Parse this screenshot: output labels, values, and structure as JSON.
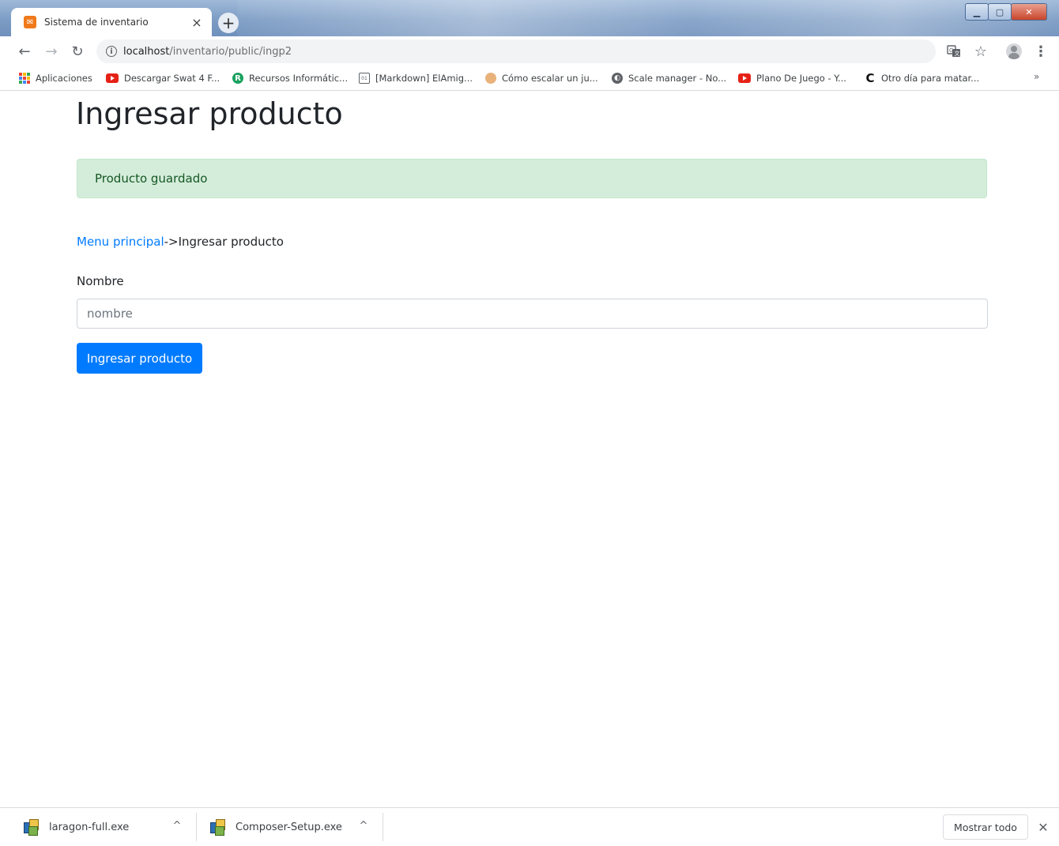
{
  "browser": {
    "tab_title": "Sistema de inventario",
    "tab_close": "×",
    "new_tab": "+",
    "url_host": "localhost",
    "url_path": "/inventario/public/ingp2",
    "bookmarks": [
      {
        "label": "Aplicaciones"
      },
      {
        "label": "Descargar Swat 4 F..."
      },
      {
        "label": "Recursos Informátic..."
      },
      {
        "label": "[Markdown] ElAmig..."
      },
      {
        "label": "Cómo escalar un ju..."
      },
      {
        "label": "Scale manager - No..."
      },
      {
        "label": "Plano De Juego - Y..."
      },
      {
        "label": "Otro día para matar..."
      }
    ],
    "bookmarks_more": "»",
    "colors": {
      "youtube": "#e62117",
      "accent": "#007bff"
    }
  },
  "page": {
    "title": "Ingresar producto",
    "alert": "Producto guardado",
    "breadcrumb_link": "Menu principal",
    "breadcrumb_sep": "->",
    "breadcrumb_current": "Ingresar producto",
    "field_label": "Nombre",
    "field_placeholder": "nombre",
    "field_value": "",
    "submit_label": "Ingresar producto"
  },
  "downloads": {
    "items": [
      {
        "name": "laragon-full.exe"
      },
      {
        "name": "Composer-Setup.exe"
      }
    ],
    "show_all": "Mostrar todo"
  }
}
